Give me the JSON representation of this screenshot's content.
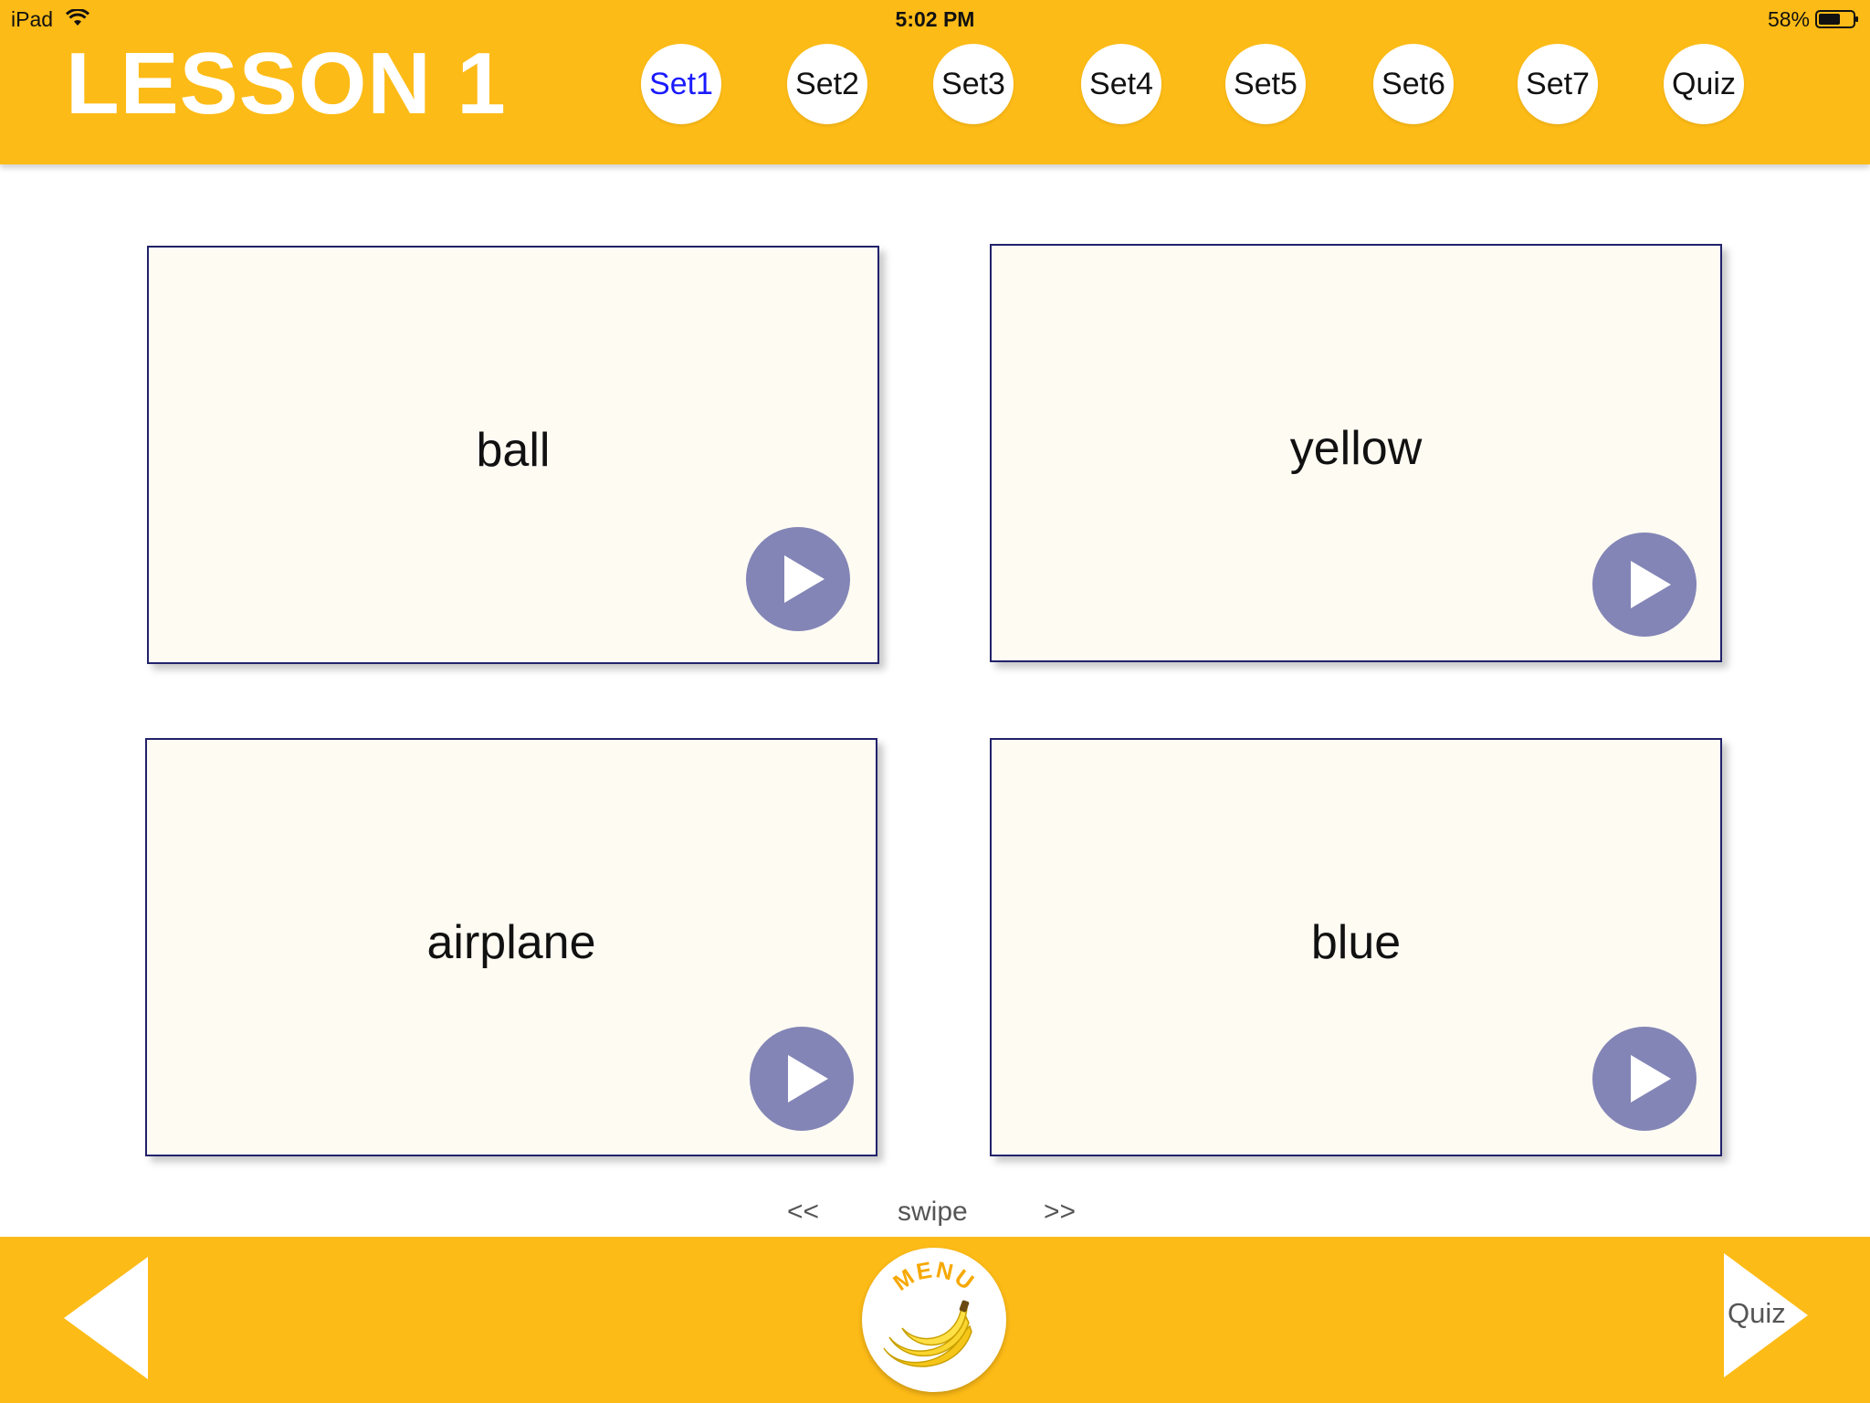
{
  "status_bar": {
    "device": "iPad",
    "time": "5:02 PM",
    "battery": "58%",
    "icons": [
      "wifi-icon",
      "battery-icon"
    ]
  },
  "header": {
    "title": "LESSON 1",
    "tabs": [
      {
        "label": "Set1",
        "active": true
      },
      {
        "label": "Set2",
        "active": false
      },
      {
        "label": "Set3",
        "active": false
      },
      {
        "label": "Set4",
        "active": false
      },
      {
        "label": "Set5",
        "active": false
      },
      {
        "label": "Set6",
        "active": false
      },
      {
        "label": "Set7",
        "active": false
      },
      {
        "label": "Quiz",
        "active": false
      }
    ]
  },
  "cards": [
    {
      "word": "ball",
      "icon": "play-icon"
    },
    {
      "word": "yellow",
      "icon": "play-icon"
    },
    {
      "word": "airplane",
      "icon": "play-icon"
    },
    {
      "word": "blue",
      "icon": "play-icon"
    }
  ],
  "swipe": {
    "prev": "<<",
    "label": "swipe",
    "next": ">>"
  },
  "footer": {
    "back_icon": "back-arrow-icon",
    "menu_label": "MENU",
    "menu_icon": "banana-icon",
    "forward_label": "Quiz",
    "forward_icon": "forward-arrow-icon"
  },
  "colors": {
    "accent": "#FDBB17",
    "card_bg": "#FEFBF3",
    "card_border": "#22226B",
    "play_button": "#8385B6",
    "active_tab_text": "#1A1AFF"
  }
}
